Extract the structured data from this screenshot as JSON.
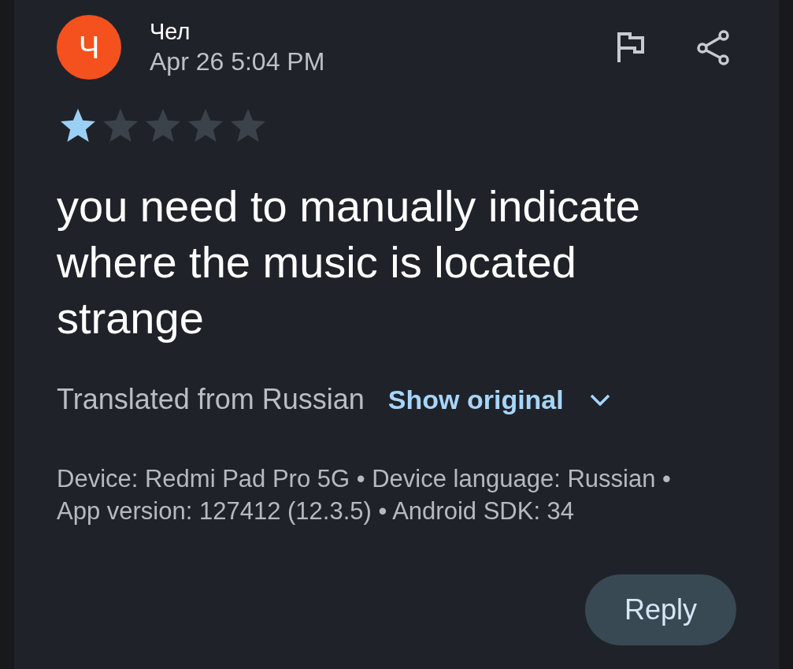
{
  "review": {
    "avatar_initial": "Ч",
    "author": "Чел",
    "date": "Apr 26 5:04 PM",
    "stars": 1,
    "text": "you need to manually indicate where the music is located strange"
  },
  "translation": {
    "note": "Translated from Russian",
    "action": "Show original"
  },
  "device_info": "Device: Redmi Pad Pro 5G • Device language: Russian • App version: 127412 (12.3.5) • Android SDK: 34",
  "reply_button": "Reply"
}
